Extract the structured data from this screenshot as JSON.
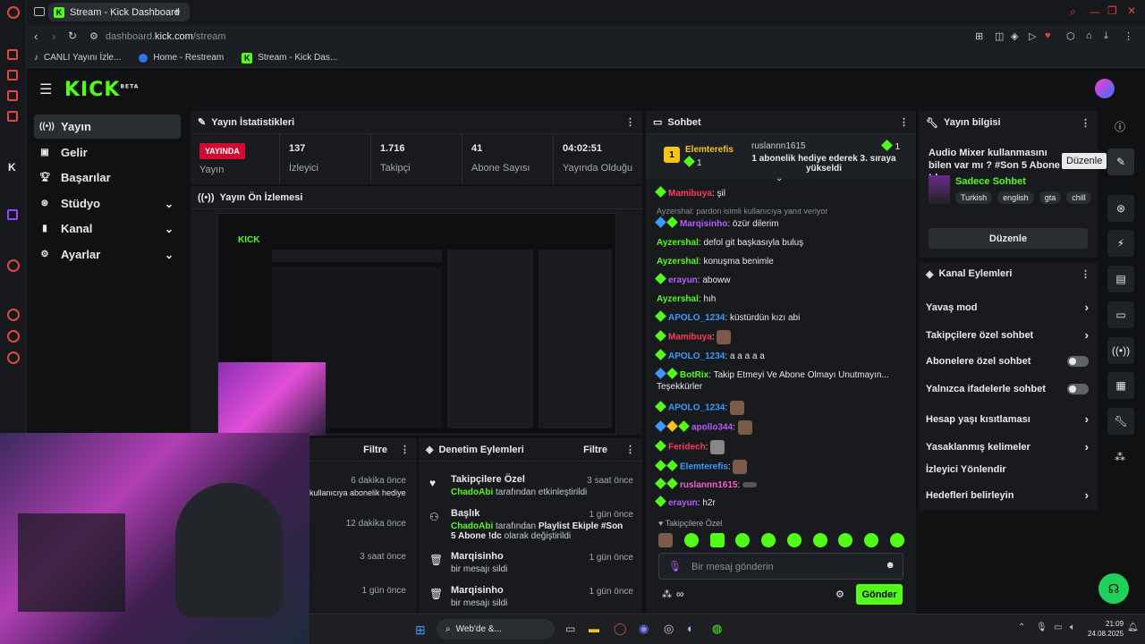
{
  "browser": {
    "tab_title": "Stream - Kick Dashboard",
    "add_tab": "+",
    "url_prefix": "dashboard.",
    "url_host": "kick.com",
    "url_path": "/stream",
    "bookmarks": [
      "CANLI Yayını İzle...",
      "Home - Restream",
      "Stream - Kick Das..."
    ]
  },
  "kick": {
    "logo": "KICK",
    "logo_badge": "BETA",
    "nav": [
      {
        "label": "Yayın",
        "icon": "broadcast-icon",
        "active": true
      },
      {
        "label": "Gelir",
        "icon": "revenue-icon"
      },
      {
        "label": "Başarılar",
        "icon": "trophy-icon"
      },
      {
        "label": "Stüdyo",
        "icon": "studio-icon",
        "expand": true
      },
      {
        "label": "Kanal",
        "icon": "channel-icon",
        "expand": true
      },
      {
        "label": "Ayarlar",
        "icon": "settings-icon",
        "expand": true
      }
    ]
  },
  "stats": {
    "title": "Yayın İstatistikleri",
    "live_badge": "YAYINDA",
    "live_label": "Yayın",
    "items": [
      {
        "value": "137",
        "label": "İzleyici"
      },
      {
        "value": "1.716",
        "label": "Takipçi"
      },
      {
        "value": "41",
        "label": "Abone Sayısı"
      },
      {
        "value": "04:02:51",
        "label": "Yayında Olduğu"
      }
    ]
  },
  "preview": {
    "title": "Yayın Ön İzlemesi"
  },
  "activity": {
    "filter": "Filtre",
    "rows": [
      {
        "time": "6 dakika önce",
        "text": "kullanıcıya abonelik hediye"
      },
      {
        "time": "12 dakika önce",
        "text": ""
      },
      {
        "time": "3 saat önce",
        "text": ""
      },
      {
        "time": "1 gün önce",
        "text": ""
      }
    ]
  },
  "moderation": {
    "title": "Denetim Eylemleri",
    "filter": "Filtre",
    "rows": [
      {
        "title": "Takipçilere Özel",
        "user": "ChadoAbi",
        "detail": " tarafından etkinleştirildi",
        "time": "3 saat önce"
      },
      {
        "title": "Başlık",
        "user": "ChadoAbi",
        "detail": " tarafından ",
        "detail_bold": "Playlist Ekiple #Son 5 Abone !dc",
        "detail_end": " olarak değiştirildi",
        "time": "1 gün önce"
      },
      {
        "title": "Marqisinho",
        "detail": "bir mesajı sildi",
        "time": "1 gün önce"
      },
      {
        "title": "Marqisinho",
        "detail": "bir mesajı sildi",
        "time": "1 gün önce"
      }
    ]
  },
  "chat": {
    "title": "Sohbet",
    "top_gifter": "Elemterefis",
    "top_gifter_count": "1",
    "second_user": "ruslannn1615",
    "second_count": "1",
    "gift_msg": "1 abonelik hediye ederek 3. sıraya yükseldi",
    "reply_note": "Ayzershal: pardon isimli kullanıcıya yanıt veriyor",
    "messages": [
      {
        "user": "Mamibuya",
        "color": "#ff3b5c",
        "text": "şil"
      },
      {
        "user": "Marqisinho",
        "color": "#b55cff",
        "text": "özür dilerim"
      },
      {
        "user": "Ayzershal",
        "color": "#53fc18",
        "text": "defol git başkasıyla buluş"
      },
      {
        "user": "Ayzershal",
        "color": "#53fc18",
        "text": "konuşma benimle"
      },
      {
        "user": "erayun",
        "color": "#b55cff",
        "text": "aboww"
      },
      {
        "user": "Ayzershal",
        "color": "#53fc18",
        "text": "hıh"
      },
      {
        "user": "APOLO_1234",
        "color": "#3a9bff",
        "text": "küstürdün kızı abi"
      },
      {
        "user": "Mamibuya",
        "color": "#ff3b5c",
        "text": ""
      },
      {
        "user": "APOLO_1234",
        "color": "#3a9bff",
        "text": "a a a a a"
      },
      {
        "user": "BotRix",
        "color": "#53fc18",
        "text": "Takip Etmeyi Ve Abone Olmayı Unutmayın... Teşekkürler"
      },
      {
        "user": "APOLO_1234",
        "color": "#3a9bff",
        "text": ""
      },
      {
        "user": "apollo344",
        "color": "#b55cff",
        "text": ""
      },
      {
        "user": "Feridech",
        "color": "#ff3b5c",
        "text": ""
      },
      {
        "user": "Elemterefis",
        "color": "#3a9bff",
        "text": ""
      },
      {
        "user": "ruslannn1615",
        "color": "#ff5ad1",
        "text": ""
      },
      {
        "user": "erayun",
        "color": "#b55cff",
        "text": "h2r"
      }
    ],
    "followers_only": "Takipçilere Özel",
    "input_placeholder": "Bir mesaj gönderin",
    "send": "Gönder"
  },
  "stream_info": {
    "title": "Yayın bilgisi",
    "stream_title": "Audio Mixer kullanmasını bilen var mı ? #Son 5 Abone !dc",
    "category": "Sadece Sohbet",
    "tags": [
      "Turkish",
      "english",
      "gta",
      "chill"
    ],
    "edit": "Düzenle",
    "tooltip": "Düzenle"
  },
  "channel_actions": {
    "title": "Kanal Eylemleri",
    "rows": [
      {
        "label": "Yavaş mod",
        "type": "arrow"
      },
      {
        "label": "Takipçilere özel sohbet",
        "type": "arrow"
      },
      {
        "label": "Abonelere özel sohbet",
        "type": "toggle"
      },
      {
        "label": "Yalnızca ifadelerle sohbet",
        "type": "toggle"
      },
      {
        "label": "Hesap yaşı kısıtlaması",
        "type": "arrow"
      },
      {
        "label": "Yasaklanmış kelimeler",
        "type": "arrow"
      },
      {
        "label": "İzleyici Yönlendir",
        "type": "none"
      },
      {
        "label": "Hedefleri belirleyin",
        "type": "arrow"
      }
    ]
  },
  "taskbar": {
    "search": "Web'de &...",
    "time": "21:09",
    "date": "24.08.2025"
  },
  "colors": {
    "kick_green": "#53fc18",
    "live_red": "#d20a32",
    "panel": "#181a1d"
  }
}
